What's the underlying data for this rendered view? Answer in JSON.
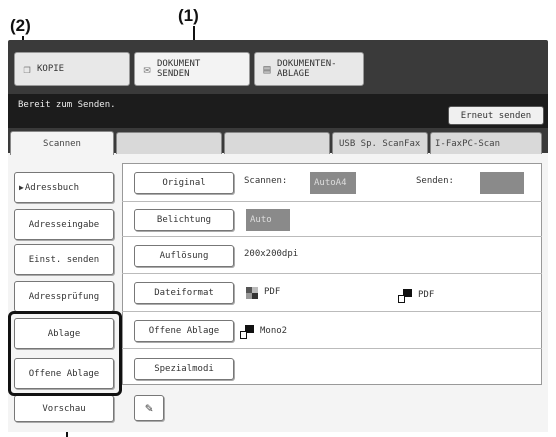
{
  "callouts": {
    "c1": "(1)",
    "c2": "(2)"
  },
  "top_buttons": [
    {
      "label": "KOPIE",
      "icon": "copy-icon"
    },
    {
      "label_line1": "DOKUMENT",
      "label_line2": "SENDEN",
      "icon": "send-icon"
    },
    {
      "label_line1": "DOKUMENTEN-",
      "label_line2": "ABLAGE",
      "icon": "filing-icon"
    }
  ],
  "status": {
    "message": "Bereit zum Senden.",
    "resend_label": "Erneut senden"
  },
  "tabs": [
    "Scannen",
    "",
    "",
    "USB Sp. Scan",
    "Fax",
    "I-Fax",
    "PC-Scan"
  ],
  "tab_labels": {
    "t0": "Scannen",
    "t3": "USB Sp. Scan",
    "t4": "Fax",
    "t5": "I-Fax",
    "t6": "PC-Scan"
  },
  "left_buttons": {
    "address_book": "Adressbuch",
    "address_entry": "Adresseingabe",
    "settings_send": "Einst. senden",
    "address_check": "Adressprüfung",
    "filing": "Ablage",
    "quick_filing": "Offene Ablage",
    "preview": "Vorschau"
  },
  "options": {
    "original": "Original",
    "scan_label": "Scannen:",
    "scan_value": "AutoA4",
    "send_label": "Senden:",
    "send_value": "",
    "exposure": "Belichtung",
    "exposure_value": "Auto",
    "resolution": "Auflösung",
    "resolution_value": "200x200dpi",
    "file_format": "Dateiformat",
    "format_color": "PDF",
    "format_bw": "PDF",
    "quick_filing_opt": "Offene Ablage",
    "quick_filing_value": "Mono2",
    "special_modes": "Spezialmodi"
  },
  "colors": {
    "frame": "#3a3a3a",
    "status_bg": "#1c1c1c",
    "panel": "#f4f4f4",
    "highlight": "#111111"
  }
}
